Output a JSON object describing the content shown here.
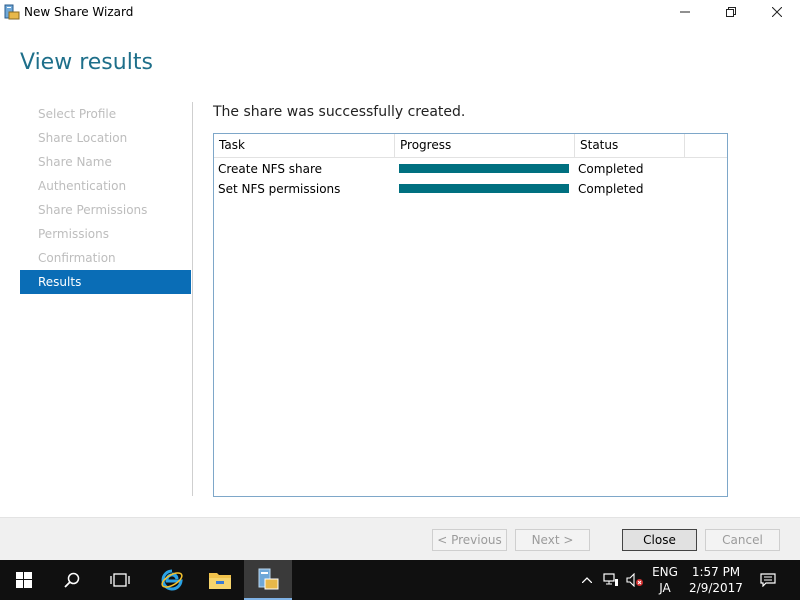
{
  "window": {
    "title": "New Share Wizard",
    "controls": {
      "minimize": "—",
      "maximize": "❐",
      "close": "✕"
    }
  },
  "heading": "View results",
  "nav": {
    "items": [
      {
        "label": "Select Profile",
        "active": false
      },
      {
        "label": "Share Location",
        "active": false
      },
      {
        "label": "Share Name",
        "active": false
      },
      {
        "label": "Authentication",
        "active": false
      },
      {
        "label": "Share Permissions",
        "active": false
      },
      {
        "label": "Permissions",
        "active": false
      },
      {
        "label": "Confirmation",
        "active": false
      },
      {
        "label": "Results",
        "active": true
      }
    ]
  },
  "results": {
    "message": "The share was successfully created.",
    "columns": {
      "task": "Task",
      "progress": "Progress",
      "status": "Status"
    },
    "rows": [
      {
        "task": "Create NFS share",
        "progress_percent": 100,
        "status": "Completed"
      },
      {
        "task": "Set NFS permissions",
        "progress_percent": 100,
        "status": "Completed"
      }
    ]
  },
  "buttons": {
    "previous": "< Previous",
    "next": "Next >",
    "close": "Close",
    "cancel": "Cancel"
  },
  "taskbar": {
    "lang_top": "ENG",
    "lang_bottom": "JA",
    "time": "1:57 PM",
    "date": "2/9/2017",
    "tray_chevron": "^"
  },
  "colors": {
    "heading": "#1e6f8a",
    "nav_active": "#0a6db6",
    "progress_fill": "#007080",
    "taskbar": "#101010"
  }
}
